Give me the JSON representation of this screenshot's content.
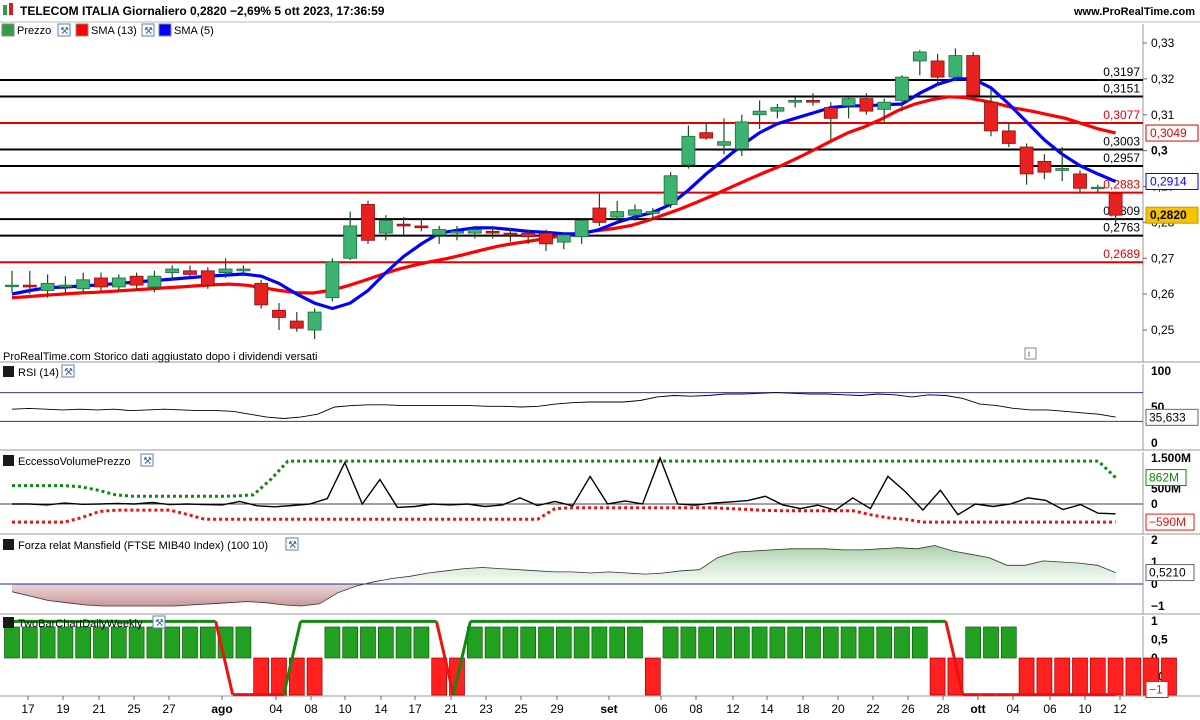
{
  "header": {
    "title": "TELECOM ITALIA Giornaliero 0,2820 −2,69% 5 ott 2023, 17:36:59",
    "brand": "www.ProRealTime.com"
  },
  "legend_price": [
    {
      "label": "Prezzo",
      "icon": "candlestick-icon",
      "color": "#cc2a1e"
    },
    {
      "label": "SMA (13)",
      "icon": "red-square-icon",
      "color": "#ff0000"
    },
    {
      "label": "SMA (5)",
      "icon": "blue-square-icon",
      "color": "#0000ff"
    }
  ],
  "footnote": "ProRealTime.com Storico dati aggiustato dopo i dividendi versati",
  "panels": {
    "rsi": {
      "label": "RSI (14)",
      "value": "35,633",
      "ticks": [
        "100",
        "50",
        "0"
      ]
    },
    "evp": {
      "label": "EccessoVolumePrezzo",
      "upper": "862M",
      "lower": "−590M",
      "ticks": [
        "1.500M",
        "500M",
        "0",
        "−500M"
      ]
    },
    "mansfield": {
      "label": "Forza relat Mansfield (FTSE MIB40 Index) (100 10)",
      "value": "0,5210",
      "ticks": [
        "2",
        "1",
        "0",
        "−1"
      ]
    },
    "twobar": {
      "label": "TwoBarChartDailyWeekly",
      "value": "−1",
      "ticks": [
        "1",
        "0,5",
        "0",
        "−0,5"
      ]
    }
  },
  "chart_data": {
    "type": "candlestick",
    "title": "TELECOM ITALIA Giornaliero",
    "last": 0.282,
    "change_pct": -2.69,
    "ylim": [
      0.243,
      0.335
    ],
    "y_ticks": [
      "0,33",
      "0,32",
      "0,31",
      "0,3",
      "0,29",
      "0,28",
      "0,27",
      "0,26",
      "0,25"
    ],
    "x_ticks": [
      "17",
      "19",
      "21",
      "25",
      "27",
      "ago",
      "04",
      "08",
      "10",
      "14",
      "17",
      "21",
      "23",
      "25",
      "29",
      "set",
      "06",
      "08",
      "12",
      "14",
      "18",
      "20",
      "22",
      "26",
      "28",
      "ott",
      "04",
      "06",
      "10",
      "12"
    ],
    "horizontal_levels": [
      {
        "value": 0.3197,
        "label": "0,3197",
        "color": "#000000"
      },
      {
        "value": 0.3151,
        "label": "0,3151",
        "color": "#000000"
      },
      {
        "value": 0.3077,
        "label": "0,3077",
        "color": "#e00000"
      },
      {
        "value": 0.3003,
        "label": "0,3003",
        "color": "#000000"
      },
      {
        "value": 0.2957,
        "label": "0,2957",
        "color": "#000000"
      },
      {
        "value": 0.2883,
        "label": "0,2883",
        "color": "#e00000"
      },
      {
        "value": 0.2809,
        "label": "0,2809",
        "color": "#000000"
      },
      {
        "value": 0.2763,
        "label": "0,2763",
        "color": "#000000"
      },
      {
        "value": 0.2689,
        "label": "0,2689",
        "color": "#e00000"
      }
    ],
    "right_labels": [
      {
        "value": 0.3049,
        "label": "0,3049",
        "color": "#e00000"
      },
      {
        "value": 0.2914,
        "label": "0,2914",
        "color": "#0000ff"
      },
      {
        "value": 0.282,
        "label": "0,2820",
        "color": "#000000",
        "bg": "#f5c400"
      }
    ],
    "candles": [
      {
        "o": 0.2625,
        "h": 0.2665,
        "l": 0.2605,
        "c": 0.2625
      },
      {
        "o": 0.2625,
        "h": 0.2665,
        "l": 0.26,
        "c": 0.262
      },
      {
        "o": 0.261,
        "h": 0.2655,
        "l": 0.259,
        "c": 0.263
      },
      {
        "o": 0.262,
        "h": 0.265,
        "l": 0.26,
        "c": 0.2625
      },
      {
        "o": 0.2615,
        "h": 0.266,
        "l": 0.2605,
        "c": 0.264
      },
      {
        "o": 0.2645,
        "h": 0.266,
        "l": 0.261,
        "c": 0.262
      },
      {
        "o": 0.262,
        "h": 0.2655,
        "l": 0.261,
        "c": 0.2645
      },
      {
        "o": 0.265,
        "h": 0.266,
        "l": 0.261,
        "c": 0.2625
      },
      {
        "o": 0.262,
        "h": 0.2665,
        "l": 0.2605,
        "c": 0.265
      },
      {
        "o": 0.266,
        "h": 0.268,
        "l": 0.264,
        "c": 0.267
      },
      {
        "o": 0.2665,
        "h": 0.268,
        "l": 0.2645,
        "c": 0.2655
      },
      {
        "o": 0.2665,
        "h": 0.2675,
        "l": 0.2615,
        "c": 0.2625
      },
      {
        "o": 0.266,
        "h": 0.27,
        "l": 0.2645,
        "c": 0.267
      },
      {
        "o": 0.2665,
        "h": 0.268,
        "l": 0.265,
        "c": 0.267
      },
      {
        "o": 0.263,
        "h": 0.264,
        "l": 0.256,
        "c": 0.257
      },
      {
        "o": 0.2555,
        "h": 0.2575,
        "l": 0.25,
        "c": 0.2535
      },
      {
        "o": 0.2525,
        "h": 0.255,
        "l": 0.2495,
        "c": 0.2505
      },
      {
        "o": 0.25,
        "h": 0.256,
        "l": 0.2475,
        "c": 0.255
      },
      {
        "o": 0.259,
        "h": 0.27,
        "l": 0.258,
        "c": 0.269
      },
      {
        "o": 0.27,
        "h": 0.283,
        "l": 0.2695,
        "c": 0.279
      },
      {
        "o": 0.285,
        "h": 0.286,
        "l": 0.274,
        "c": 0.275
      },
      {
        "o": 0.277,
        "h": 0.282,
        "l": 0.275,
        "c": 0.2805
      },
      {
        "o": 0.2795,
        "h": 0.2815,
        "l": 0.2765,
        "c": 0.279
      },
      {
        "o": 0.279,
        "h": 0.281,
        "l": 0.2775,
        "c": 0.2785
      },
      {
        "o": 0.2765,
        "h": 0.279,
        "l": 0.274,
        "c": 0.278
      },
      {
        "o": 0.277,
        "h": 0.279,
        "l": 0.275,
        "c": 0.2775
      },
      {
        "o": 0.277,
        "h": 0.279,
        "l": 0.2755,
        "c": 0.278
      },
      {
        "o": 0.2775,
        "h": 0.279,
        "l": 0.2755,
        "c": 0.277
      },
      {
        "o": 0.277,
        "h": 0.2785,
        "l": 0.2745,
        "c": 0.2765
      },
      {
        "o": 0.277,
        "h": 0.278,
        "l": 0.274,
        "c": 0.276
      },
      {
        "o": 0.277,
        "h": 0.278,
        "l": 0.272,
        "c": 0.274
      },
      {
        "o": 0.2745,
        "h": 0.277,
        "l": 0.2725,
        "c": 0.2765
      },
      {
        "o": 0.276,
        "h": 0.281,
        "l": 0.274,
        "c": 0.2805
      },
      {
        "o": 0.284,
        "h": 0.288,
        "l": 0.279,
        "c": 0.28
      },
      {
        "o": 0.2815,
        "h": 0.286,
        "l": 0.28,
        "c": 0.283
      },
      {
        "o": 0.282,
        "h": 0.285,
        "l": 0.2805,
        "c": 0.2835
      },
      {
        "o": 0.2825,
        "h": 0.284,
        "l": 0.281,
        "c": 0.283
      },
      {
        "o": 0.285,
        "h": 0.294,
        "l": 0.284,
        "c": 0.293
      },
      {
        "o": 0.296,
        "h": 0.307,
        "l": 0.295,
        "c": 0.304
      },
      {
        "o": 0.305,
        "h": 0.308,
        "l": 0.303,
        "c": 0.3035
      },
      {
        "o": 0.3015,
        "h": 0.309,
        "l": 0.299,
        "c": 0.3025
      },
      {
        "o": 0.3005,
        "h": 0.31,
        "l": 0.2985,
        "c": 0.308
      },
      {
        "o": 0.31,
        "h": 0.314,
        "l": 0.306,
        "c": 0.311
      },
      {
        "o": 0.311,
        "h": 0.313,
        "l": 0.309,
        "c": 0.312
      },
      {
        "o": 0.3135,
        "h": 0.315,
        "l": 0.312,
        "c": 0.314
      },
      {
        "o": 0.314,
        "h": 0.316,
        "l": 0.3125,
        "c": 0.3135
      },
      {
        "o": 0.312,
        "h": 0.3135,
        "l": 0.303,
        "c": 0.309
      },
      {
        "o": 0.3125,
        "h": 0.315,
        "l": 0.309,
        "c": 0.3145
      },
      {
        "o": 0.3145,
        "h": 0.316,
        "l": 0.31,
        "c": 0.311
      },
      {
        "o": 0.3115,
        "h": 0.3145,
        "l": 0.3075,
        "c": 0.3135
      },
      {
        "o": 0.314,
        "h": 0.321,
        "l": 0.311,
        "c": 0.3205
      },
      {
        "o": 0.325,
        "h": 0.328,
        "l": 0.321,
        "c": 0.3275
      },
      {
        "o": 0.325,
        "h": 0.327,
        "l": 0.318,
        "c": 0.3205
      },
      {
        "o": 0.3205,
        "h": 0.3285,
        "l": 0.3195,
        "c": 0.3265
      },
      {
        "o": 0.3265,
        "h": 0.3275,
        "l": 0.314,
        "c": 0.3155
      },
      {
        "o": 0.3135,
        "h": 0.317,
        "l": 0.304,
        "c": 0.3055
      },
      {
        "o": 0.3055,
        "h": 0.308,
        "l": 0.301,
        "c": 0.302
      },
      {
        "o": 0.301,
        "h": 0.302,
        "l": 0.2905,
        "c": 0.2935
      },
      {
        "o": 0.297,
        "h": 0.299,
        "l": 0.292,
        "c": 0.294
      },
      {
        "o": 0.2945,
        "h": 0.301,
        "l": 0.2915,
        "c": 0.295
      },
      {
        "o": 0.2935,
        "h": 0.2945,
        "l": 0.288,
        "c": 0.2895
      },
      {
        "o": 0.2898,
        "h": 0.2905,
        "l": 0.2885,
        "c": 0.2898
      },
      {
        "o": 0.288,
        "h": 0.2885,
        "l": 0.279,
        "c": 0.282
      }
    ],
    "sma13": [
      0.259,
      0.2593,
      0.2597,
      0.26,
      0.2603,
      0.2605,
      0.2608,
      0.2611,
      0.2614,
      0.2617,
      0.262,
      0.2623,
      0.2626,
      0.2628,
      0.2625,
      0.2618,
      0.261,
      0.2604,
      0.2603,
      0.261,
      0.2622,
      0.2637,
      0.2653,
      0.2668,
      0.268,
      0.269,
      0.2699,
      0.271,
      0.2722,
      0.2733,
      0.2741,
      0.2748,
      0.2756,
      0.2764,
      0.277,
      0.2777,
      0.2783,
      0.2791,
      0.2805,
      0.2821,
      0.2838,
      0.2857,
      0.2877,
      0.2898,
      0.2919,
      0.2939,
      0.2958,
      0.298,
      0.3003,
      0.3027,
      0.305,
      0.3067,
      0.3088,
      0.3112,
      0.313,
      0.3142,
      0.315,
      0.3148,
      0.314,
      0.313,
      0.3118,
      0.311,
      0.31,
      0.309,
      0.3075,
      0.306,
      0.3049
    ],
    "sma5": [
      0.26,
      0.261,
      0.2618,
      0.262,
      0.2623,
      0.2626,
      0.263,
      0.2634,
      0.2638,
      0.2642,
      0.2646,
      0.265,
      0.2653,
      0.2656,
      0.265,
      0.263,
      0.26,
      0.2575,
      0.256,
      0.2575,
      0.261,
      0.266,
      0.2705,
      0.274,
      0.277,
      0.2778,
      0.2785,
      0.2785,
      0.278,
      0.2775,
      0.2772,
      0.2768,
      0.2768,
      0.278,
      0.28,
      0.2815,
      0.2828,
      0.285,
      0.289,
      0.2935,
      0.2975,
      0.3015,
      0.305,
      0.3075,
      0.309,
      0.3105,
      0.312,
      0.3125,
      0.3125,
      0.3128,
      0.313,
      0.316,
      0.3185,
      0.32,
      0.32,
      0.3175,
      0.313,
      0.308,
      0.303,
      0.299,
      0.2958,
      0.2935,
      0.2914
    ],
    "rsi": [
      47,
      48,
      47,
      46,
      47,
      46,
      47,
      45,
      46,
      47,
      46,
      45,
      45,
      44,
      40,
      36,
      34,
      36,
      40,
      50,
      52,
      53,
      53,
      52,
      52,
      52,
      52,
      52,
      51,
      51,
      50,
      51,
      54,
      56,
      57,
      57,
      57,
      59,
      64,
      66,
      65,
      66,
      68,
      68,
      69,
      70,
      69,
      68,
      68,
      67,
      66,
      68,
      67,
      64,
      67,
      66,
      62,
      54,
      52,
      48,
      46,
      46,
      44,
      42,
      40,
      36
    ],
    "evp_line": [
      0,
      0,
      -30,
      30,
      -10,
      0,
      20,
      0,
      50,
      -20,
      0,
      -20,
      -30,
      80,
      -60,
      -90,
      -50,
      0,
      180,
      1350,
      0,
      800,
      -110,
      -80,
      0,
      -30,
      0,
      -80,
      -30,
      200,
      -50,
      80,
      -60,
      900,
      0,
      100,
      0,
      1500,
      0,
      -40,
      30,
      70,
      110,
      250,
      -30,
      -150,
      -40,
      -200,
      200,
      -150,
      900,
      400,
      -200,
      450,
      -350,
      0,
      -80,
      0,
      200,
      120,
      -180,
      -20,
      -300,
      -320
    ],
    "evp_upper": [
      600,
      600,
      600,
      600,
      560,
      450,
      300,
      250,
      250,
      250,
      250,
      250,
      250,
      260,
      300,
      800,
      1400,
      1400,
      1400,
      1400,
      1400,
      1400,
      1400,
      1400,
      1400,
      1400,
      1400,
      1400,
      1400,
      1400,
      1400,
      1400,
      1400,
      1400,
      1400,
      1400,
      1400,
      1400,
      1400,
      1400,
      1400,
      1400,
      1400,
      1400,
      1400,
      1400,
      1400,
      1400,
      1400,
      1400,
      1400,
      1400,
      1400,
      1400,
      1400,
      1400,
      1400,
      1400,
      1400,
      1400,
      1400,
      1400,
      1400,
      1400,
      862
    ],
    "evp_lower": [
      -590,
      -590,
      -590,
      -590,
      -440,
      -240,
      -200,
      -200,
      -200,
      -200,
      -340,
      -500,
      -500,
      -500,
      -500,
      -500,
      -500,
      -500,
      -500,
      -500,
      -500,
      -500,
      -500,
      -500,
      -500,
      -500,
      -500,
      -500,
      -500,
      -500,
      -500,
      -150,
      -120,
      -120,
      -120,
      -120,
      -120,
      -120,
      -120,
      -120,
      -120,
      -150,
      -180,
      -210,
      -220,
      -220,
      -220,
      -220,
      -220,
      -350,
      -450,
      -500,
      -590,
      -590,
      -590,
      -590,
      -590,
      -590,
      -590,
      -590,
      -590,
      -590,
      -590,
      -590
    ],
    "mansfield": [
      -0.35,
      -0.55,
      -0.75,
      -0.85,
      -0.95,
      -1.0,
      -1.0,
      -1.0,
      -1.0,
      -1.0,
      -0.95,
      -0.9,
      -0.85,
      -0.8,
      -0.85,
      -0.95,
      -1.0,
      -0.9,
      -0.4,
      -0.1,
      0.1,
      0.25,
      0.35,
      0.5,
      0.6,
      0.7,
      0.75,
      0.7,
      0.65,
      0.6,
      0.55,
      0.55,
      0.5,
      0.55,
      0.5,
      0.45,
      0.5,
      0.6,
      0.65,
      1.2,
      1.45,
      1.5,
      1.55,
      1.6,
      1.6,
      1.6,
      1.55,
      1.55,
      1.6,
      1.65,
      1.6,
      1.75,
      1.5,
      1.35,
      1.2,
      0.85,
      0.85,
      1.05,
      1.0,
      0.95,
      0.85,
      0.52
    ],
    "twobar": [
      1,
      1,
      1,
      1,
      1,
      1,
      1,
      1,
      1,
      1,
      1,
      1,
      1,
      1,
      -1,
      -1,
      -1,
      -1,
      1,
      1,
      1,
      1,
      1,
      1,
      -1,
      -1,
      1,
      1,
      1,
      1,
      1,
      1,
      1,
      1,
      1,
      1,
      -1,
      1,
      1,
      1,
      1,
      1,
      1,
      1,
      1,
      1,
      1,
      1,
      1,
      1,
      1,
      1,
      -1,
      -1,
      1,
      1,
      1,
      -1,
      -1,
      -1,
      -1,
      -1,
      -1,
      -1,
      -1,
      -1
    ],
    "twobar_line": [
      1,
      1,
      1,
      1,
      1,
      1,
      1,
      1,
      1,
      1,
      1,
      1,
      1,
      -1,
      -1,
      -1,
      -1,
      1,
      1,
      1,
      1,
      1,
      1,
      1,
      1,
      1,
      -1,
      1,
      1,
      1,
      1,
      1,
      1,
      1,
      1,
      1,
      1,
      1,
      1,
      1,
      1,
      1,
      1,
      1,
      1,
      1,
      1,
      1,
      1,
      1,
      1,
      1,
      1,
      1,
      1,
      1,
      -1,
      -1,
      -1,
      -1,
      -1,
      -1,
      -1,
      -1,
      -1,
      -1
    ]
  }
}
